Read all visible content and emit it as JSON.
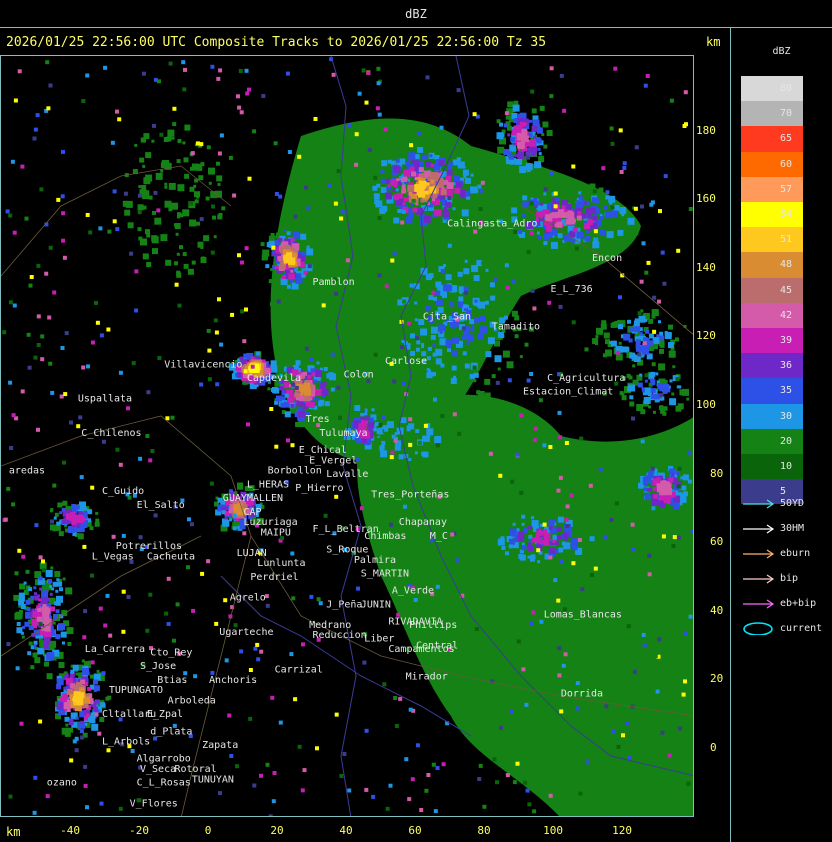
{
  "window": {
    "title": "dBZ"
  },
  "header": {
    "text": "2026/01/25 22:56:00 UTC Composite Tracks to 2026/01/25 22:56:00 Tz 35",
    "unit": "km"
  },
  "axes": {
    "y_ticks": [
      "180",
      "160",
      "140",
      "120",
      "100",
      "80",
      "60",
      "40",
      "20",
      "0"
    ],
    "x_ticks": [
      "-40",
      "-20",
      "0",
      "20",
      "40",
      "60",
      "80",
      "100",
      "120"
    ],
    "x_unit": "km"
  },
  "legend": {
    "title": "dBZ",
    "colors": [
      {
        "label": "80",
        "color": "#d8d8d8"
      },
      {
        "label": "70",
        "color": "#b4b4b4"
      },
      {
        "label": "65",
        "color": "#ff3a1f"
      },
      {
        "label": "60",
        "color": "#ff6a00"
      },
      {
        "label": "57",
        "color": "#ff9a5a"
      },
      {
        "label": "54",
        "color": "#ffff00"
      },
      {
        "label": "51",
        "color": "#ffc81e"
      },
      {
        "label": "48",
        "color": "#d98c32"
      },
      {
        "label": "45",
        "color": "#bb6d6d"
      },
      {
        "label": "42",
        "color": "#d45aaa"
      },
      {
        "label": "39",
        "color": "#c81eb4"
      },
      {
        "label": "36",
        "color": "#6e28c8"
      },
      {
        "label": "35",
        "color": "#2d50e6"
      },
      {
        "label": "30",
        "color": "#1e96e6"
      },
      {
        "label": "20",
        "color": "#148214"
      },
      {
        "label": "10",
        "color": "#0a640a"
      },
      {
        "label": "5",
        "color": "#3c3c8c"
      }
    ],
    "tracks": [
      {
        "label": "50YD",
        "color": "#4fe0e0"
      },
      {
        "label": "30HM",
        "color": "#ffffff"
      },
      {
        "label": "eburn",
        "color": "#ffb36b"
      },
      {
        "label": "bip",
        "color": "#ffcccc"
      },
      {
        "label": "eb+bip",
        "color": "#ff66ff"
      },
      {
        "label": "current",
        "color": "#00e5ff"
      }
    ]
  },
  "places": [
    {
      "name": "Uspallata",
      "x_km": -38,
      "y_km": 101
    },
    {
      "name": "C_Chilenos",
      "x_km": -37,
      "y_km": 91
    },
    {
      "name": "aredas",
      "x_km": -58,
      "y_km": 80
    },
    {
      "name": "C_Guido",
      "x_km": -31,
      "y_km": 74
    },
    {
      "name": "El_Salto",
      "x_km": -21,
      "y_km": 70
    },
    {
      "name": "Potrerillos",
      "x_km": -27,
      "y_km": 58
    },
    {
      "name": "L_Vegas",
      "x_km": -34,
      "y_km": 55
    },
    {
      "name": "Cacheuta",
      "x_km": -18,
      "y_km": 55
    },
    {
      "name": "Villavicencio",
      "x_km": -13,
      "y_km": 111
    },
    {
      "name": "Capdevila",
      "x_km": 11,
      "y_km": 107
    },
    {
      "name": "Tres",
      "x_km": 28,
      "y_km": 95
    },
    {
      "name": "Tulumaya",
      "x_km": 32,
      "y_km": 91
    },
    {
      "name": "E_Chical",
      "x_km": 26,
      "y_km": 86
    },
    {
      "name": "E_Vergel",
      "x_km": 29,
      "y_km": 83
    },
    {
      "name": "Borbollon",
      "x_km": 17,
      "y_km": 80
    },
    {
      "name": "L_HERAS",
      "x_km": 11,
      "y_km": 76
    },
    {
      "name": "Lavalle",
      "x_km": 34,
      "y_km": 79
    },
    {
      "name": "P_Hierro",
      "x_km": 25,
      "y_km": 75
    },
    {
      "name": "Tres_Porteñas",
      "x_km": 47,
      "y_km": 73
    },
    {
      "name": "GUAYMALLEN",
      "x_km": 4,
      "y_km": 72
    },
    {
      "name": "CAP",
      "x_km": 10,
      "y_km": 68
    },
    {
      "name": "Luzuriaga",
      "x_km": 10,
      "y_km": 65
    },
    {
      "name": "MAIPU",
      "x_km": 15,
      "y_km": 62
    },
    {
      "name": "F_L_Beltran",
      "x_km": 30,
      "y_km": 63
    },
    {
      "name": "Chapanay",
      "x_km": 55,
      "y_km": 65
    },
    {
      "name": "Chimbas",
      "x_km": 45,
      "y_km": 61
    },
    {
      "name": "M_C",
      "x_km": 64,
      "y_km": 61
    },
    {
      "name": "S_Roque",
      "x_km": 34,
      "y_km": 57
    },
    {
      "name": "Palmira",
      "x_km": 42,
      "y_km": 54
    },
    {
      "name": "LUJAN",
      "x_km": 8,
      "y_km": 56
    },
    {
      "name": "Lunlunta",
      "x_km": 14,
      "y_km": 53
    },
    {
      "name": "S_MARTIN",
      "x_km": 44,
      "y_km": 50
    },
    {
      "name": "Perdriel",
      "x_km": 12,
      "y_km": 49
    },
    {
      "name": "A_Verde",
      "x_km": 53,
      "y_km": 45
    },
    {
      "name": "Agrelo",
      "x_km": 6,
      "y_km": 43
    },
    {
      "name": "J_Peña",
      "x_km": 34,
      "y_km": 41
    },
    {
      "name": "JUNIN",
      "x_km": 44,
      "y_km": 41
    },
    {
      "name": "Lomas_Blancas",
      "x_km": 97,
      "y_km": 38
    },
    {
      "name": "RIVADAVIA",
      "x_km": 52,
      "y_km": 36
    },
    {
      "name": "Phillips",
      "x_km": 58,
      "y_km": 35
    },
    {
      "name": "Medrano",
      "x_km": 29,
      "y_km": 35
    },
    {
      "name": "Reduccion",
      "x_km": 30,
      "y_km": 32
    },
    {
      "name": "Ugarteche",
      "x_km": 3,
      "y_km": 33
    },
    {
      "name": "Liber",
      "x_km": 45,
      "y_km": 31
    },
    {
      "name": "La_Carrera",
      "x_km": -36,
      "y_km": 28
    },
    {
      "name": "Cto_Rey",
      "x_km": -17,
      "y_km": 27
    },
    {
      "name": "S_Jose",
      "x_km": -20,
      "y_km": 23
    },
    {
      "name": "Campamentos",
      "x_km": 52,
      "y_km": 28
    },
    {
      "name": "Central",
      "x_km": 60,
      "y_km": 29
    },
    {
      "name": "Carrizal",
      "x_km": 19,
      "y_km": 22
    },
    {
      "name": "Mirador",
      "x_km": 57,
      "y_km": 20
    },
    {
      "name": "Dorrida",
      "x_km": 102,
      "y_km": 15
    },
    {
      "name": "Anchoris",
      "x_km": 0,
      "y_km": 19
    },
    {
      "name": "Btias",
      "x_km": -15,
      "y_km": 19
    },
    {
      "name": "TUPUNGATO",
      "x_km": -29,
      "y_km": 16
    },
    {
      "name": "Arboleda",
      "x_km": -12,
      "y_km": 13
    },
    {
      "name": "Cltallaru",
      "x_km": -31,
      "y_km": 9
    },
    {
      "name": "E_Zpal",
      "x_km": -18,
      "y_km": 9
    },
    {
      "name": "d_Plata",
      "x_km": -17,
      "y_km": 4
    },
    {
      "name": "L_Arbols",
      "x_km": -31,
      "y_km": 1
    },
    {
      "name": "Zapata",
      "x_km": -2,
      "y_km": 0
    },
    {
      "name": "Algarrobo",
      "x_km": -21,
      "y_km": -4
    },
    {
      "name": "Rotoral",
      "x_km": -10,
      "y_km": -7
    },
    {
      "name": "V_Seca",
      "x_km": -20,
      "y_km": -7
    },
    {
      "name": "TUNUYAN",
      "x_km": -5,
      "y_km": -10
    },
    {
      "name": "ozano",
      "x_km": -47,
      "y_km": -11
    },
    {
      "name": "C_L_Rosas",
      "x_km": -21,
      "y_km": -11
    },
    {
      "name": "V_Flores",
      "x_km": -23,
      "y_km": -17
    },
    {
      "name": "E_L_736",
      "x_km": 99,
      "y_km": 133
    },
    {
      "name": "Encon",
      "x_km": 111,
      "y_km": 142
    },
    {
      "name": "Calingasta_Adro",
      "x_km": 69,
      "y_km": 152
    },
    {
      "name": "Cjta_San",
      "x_km": 62,
      "y_km": 125
    },
    {
      "name": "Tamadito",
      "x_km": 82,
      "y_km": 122
    },
    {
      "name": "C_Agricultura",
      "x_km": 98,
      "y_km": 107
    },
    {
      "name": "Estacion_Climat",
      "x_km": 91,
      "y_km": 103
    },
    {
      "name": "Pamblon",
      "x_km": 30,
      "y_km": 135
    },
    {
      "name": "Carlose",
      "x_km": 51,
      "y_km": 112
    },
    {
      "name": "Colon",
      "x_km": 39,
      "y_km": 108
    }
  ]
}
